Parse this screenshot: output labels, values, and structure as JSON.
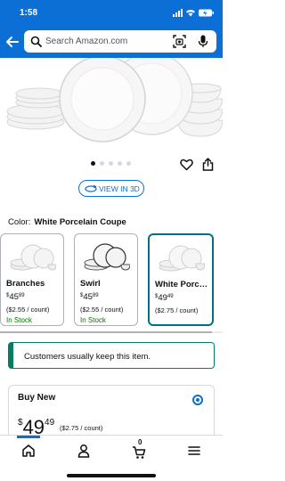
{
  "status_bar": {
    "time": "1:58"
  },
  "search": {
    "placeholder": "Search Amazon.com"
  },
  "carousel": {
    "active_index": 1,
    "count": 5
  },
  "view3d": {
    "label": "VIEW IN 3D"
  },
  "color": {
    "label": "Color:",
    "value": "White Porcelain Coupe"
  },
  "swatches": [
    {
      "name": "Branches",
      "price_symbol": "$",
      "price_whole": "45",
      "price_cents": "89",
      "unit": "($2.55 / count)",
      "stock": "In Stock",
      "selected": false
    },
    {
      "name": "Swirl",
      "price_symbol": "$",
      "price_whole": "45",
      "price_cents": "89",
      "unit": "($2.55 / count)",
      "stock": "In Stock",
      "selected": false
    },
    {
      "name": "White Porc…",
      "price_symbol": "$",
      "price_whole": "49",
      "price_cents": "49",
      "unit": "($2.75 / count)",
      "stock": "",
      "selected": true
    }
  ],
  "banner": {
    "text": "Customers usually keep this item."
  },
  "buy_new": {
    "title": "Buy New",
    "price_symbol": "$",
    "price_whole": "49",
    "price_cents": "49",
    "unit": "($2.75 / count)"
  },
  "nav": {
    "cart_count": "0"
  },
  "colors": {
    "header_blue": "#0b6fd6",
    "in_stock_green": "#007600",
    "selected_teal": "#007185",
    "banner_green": "#067d62"
  }
}
